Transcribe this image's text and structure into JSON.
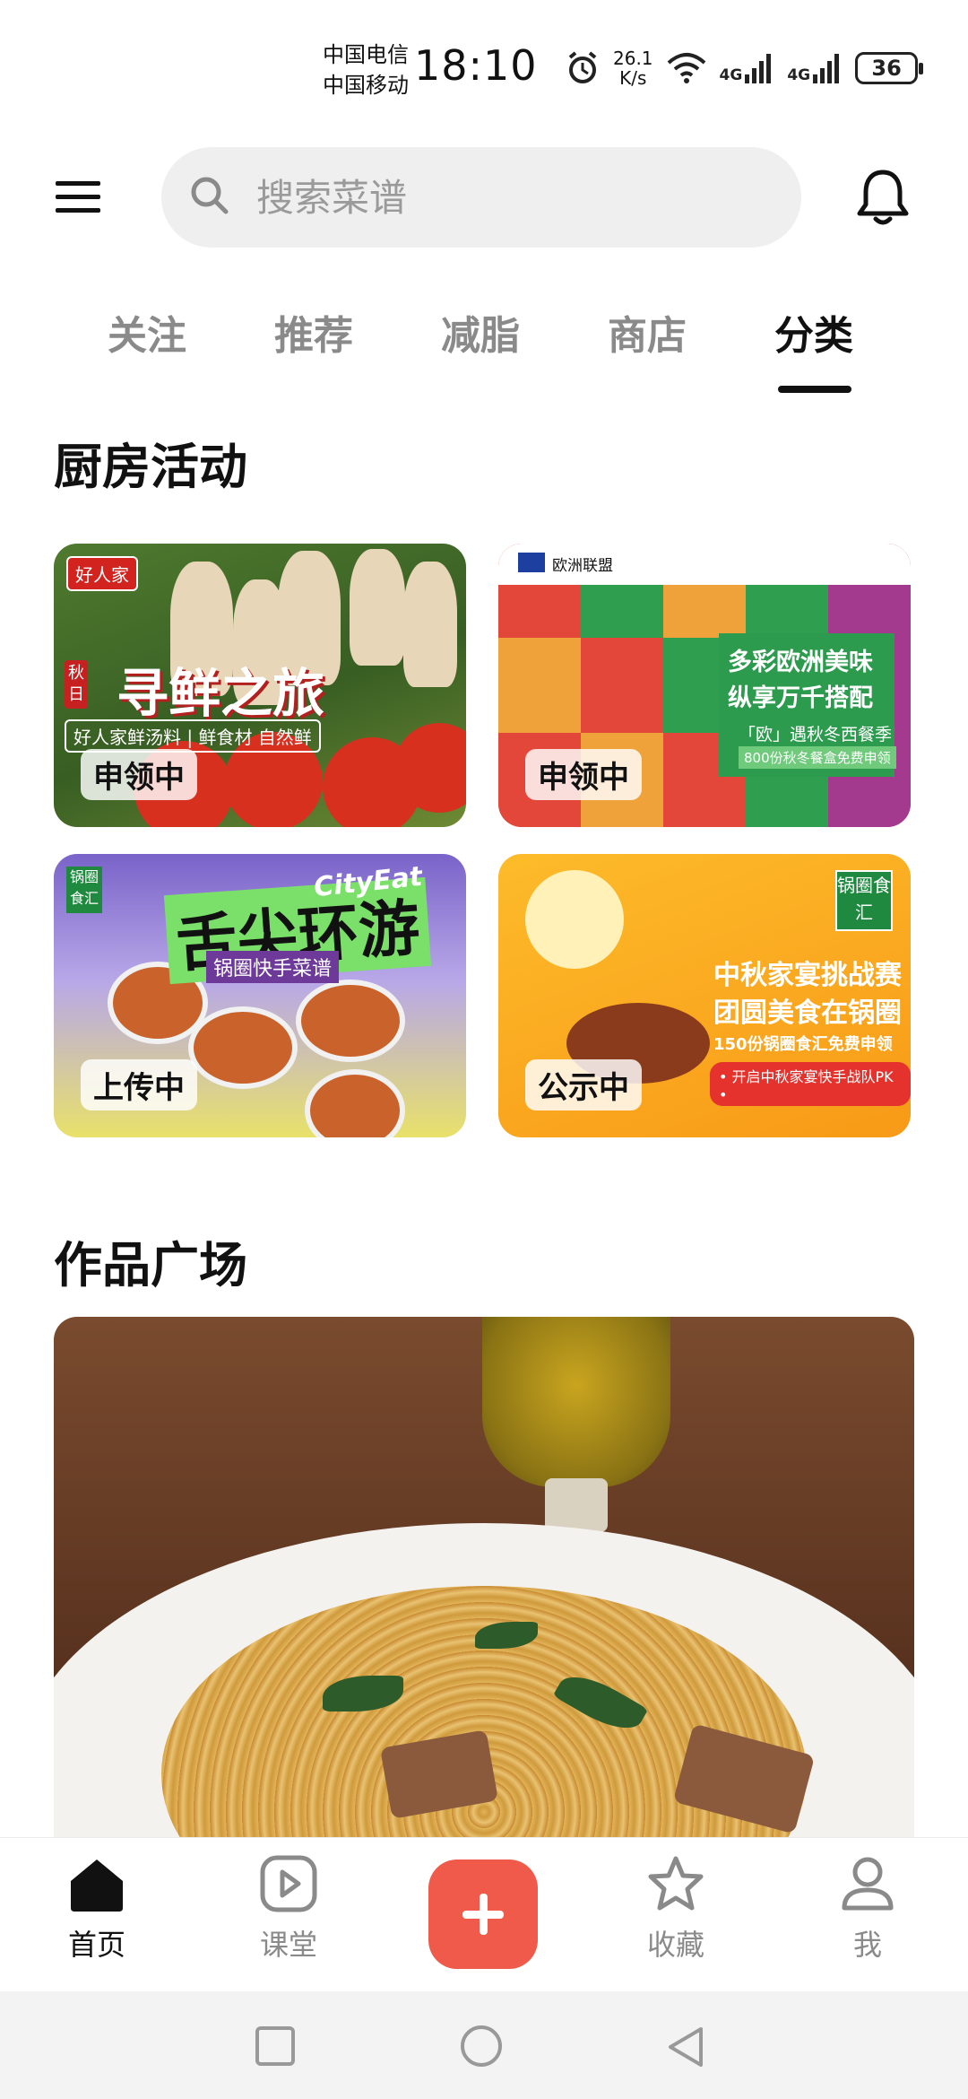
{
  "status_bar": {
    "carrier_1": "中国电信",
    "carrier_2": "中国移动",
    "time": "18:10",
    "net_speed_value": "26.1",
    "net_speed_unit": "K/s",
    "signal_1": "4G",
    "signal_2": "4G",
    "battery": "36"
  },
  "search": {
    "placeholder": "搜索菜谱"
  },
  "tabs": [
    {
      "label": "关注"
    },
    {
      "label": "推荐"
    },
    {
      "label": "减脂"
    },
    {
      "label": "商店"
    },
    {
      "label": "分类",
      "active": true
    }
  ],
  "kitchen_activities": {
    "title": "厨房活动",
    "cards": [
      {
        "status": "申领中",
        "brand": "好人家",
        "tag": "秋日",
        "headline": "寻鲜之旅",
        "subline": "好人家鲜汤料 | 鲜食材 自然鲜"
      },
      {
        "status": "申领中",
        "brand": "欧洲联盟",
        "line1": "多彩欧洲美味",
        "line2": "纵享万千搭配",
        "line3": "「欧」遇秋冬西餐季",
        "line4": "800份秋冬餐盒免费申领"
      },
      {
        "status": "上传中",
        "brand": "锅圈食汇",
        "headline": "舌尖环游",
        "headline_en": "CityEat",
        "subline": "锅圈快手菜谱"
      },
      {
        "status": "公示中",
        "brand": "锅圈食汇",
        "line1": "中秋家宴挑战赛",
        "line2": "团圆美食在锅圈",
        "line3": "150份锅圈食汇免费申领",
        "line4": "• 开启中秋家宴快手战队PK •"
      }
    ]
  },
  "works_square": {
    "title": "作品广场"
  },
  "bottom_nav": {
    "home": "首页",
    "classroom": "课堂",
    "favorites": "收藏",
    "me": "我"
  },
  "colors": {
    "accent": "#f05a4a",
    "active_text": "#111111",
    "inactive_text": "#8a8a8a"
  }
}
